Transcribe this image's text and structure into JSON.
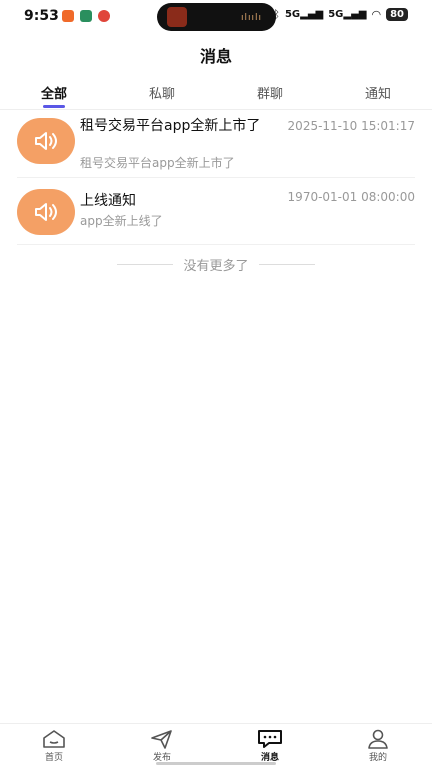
{
  "status_bar": {
    "time": "9:53",
    "signal1": "5G",
    "signal2": "5G",
    "battery": "80",
    "app_colors": [
      "#f06a2a",
      "#2a8f5e",
      "#e0453a"
    ]
  },
  "header": {
    "title": "消息"
  },
  "tabs": [
    {
      "label": "全部",
      "active": true
    },
    {
      "label": "私聊",
      "active": false
    },
    {
      "label": "群聊",
      "active": false
    },
    {
      "label": "通知",
      "active": false
    }
  ],
  "messages": [
    {
      "icon": "speaker-icon",
      "title": "租号交易平台app全新上市了",
      "preview": "租号交易平台app全新上市了",
      "time": "2025-11-10 15:01:17"
    },
    {
      "icon": "speaker-icon",
      "title": "上线通知",
      "preview": "app全新上线了",
      "time": "1970-01-01 08:00:00"
    }
  ],
  "list_footer": "没有更多了",
  "bottom_nav": [
    {
      "label": "首页",
      "icon": "home-icon",
      "active": false
    },
    {
      "label": "发布",
      "icon": "send-icon",
      "active": false
    },
    {
      "label": "消息",
      "icon": "message-icon",
      "active": true
    },
    {
      "label": "我的",
      "icon": "user-icon",
      "active": false
    }
  ],
  "colors": {
    "accent": "#5a57e6",
    "avatar": "#f4a065"
  }
}
